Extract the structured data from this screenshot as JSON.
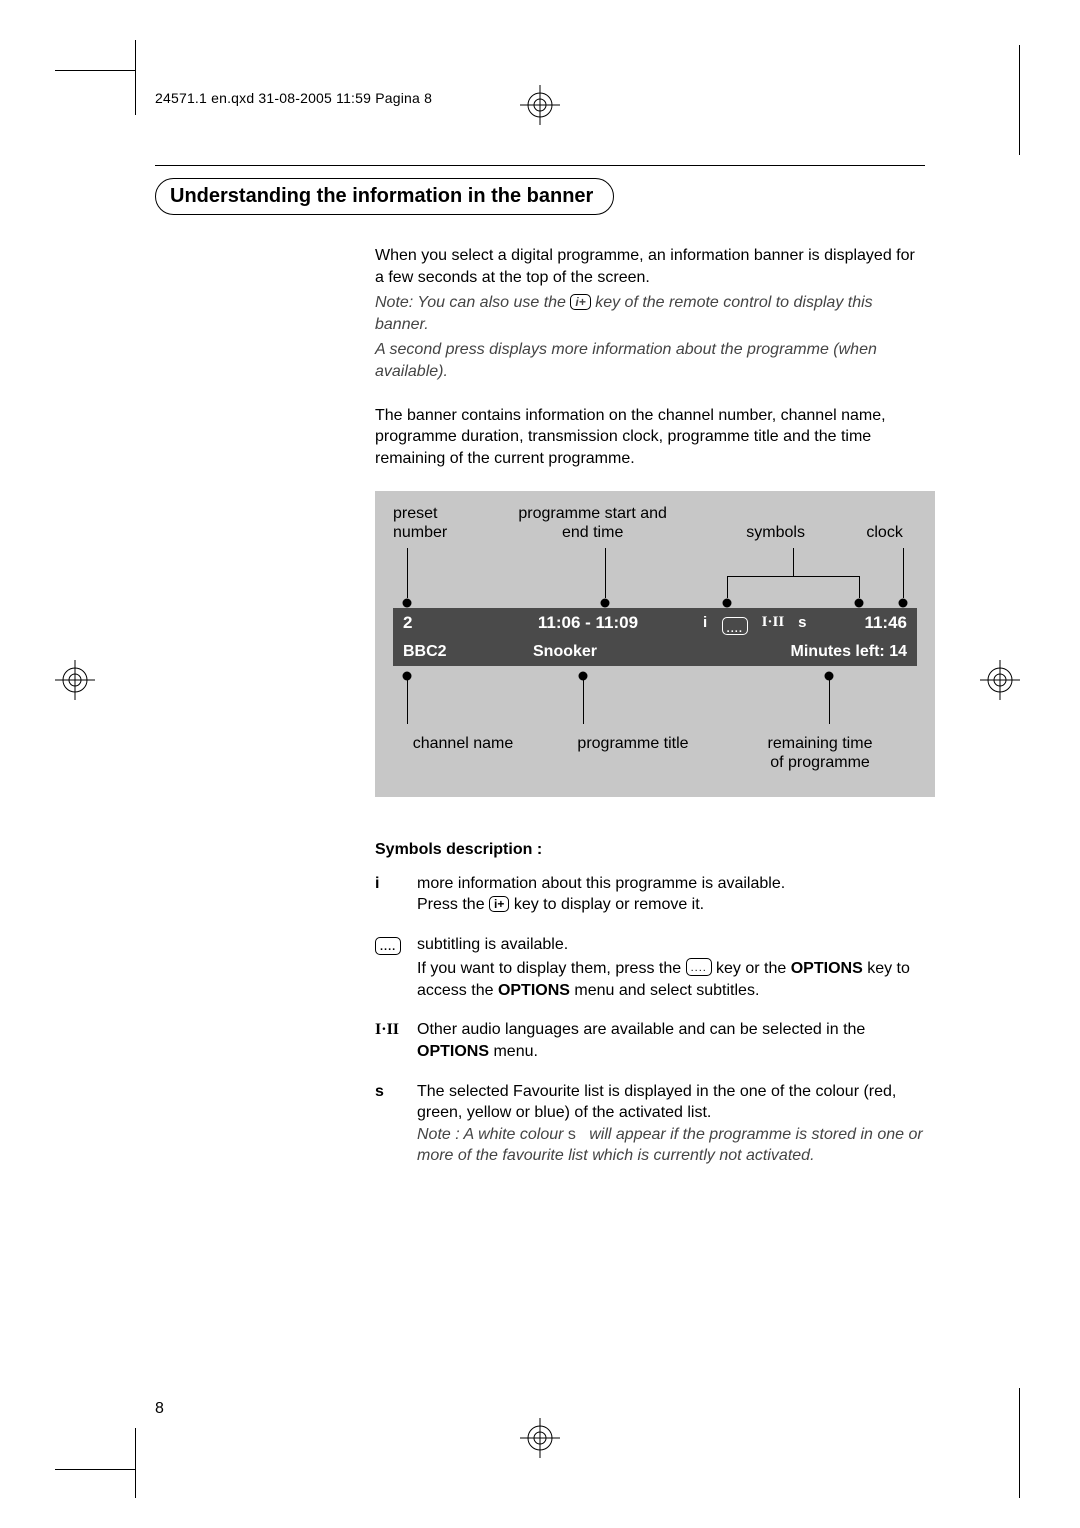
{
  "header_line": "24571.1 en.qxd  31-08-2005  11:59  Pagina 8",
  "title": "Understanding the information in the banner",
  "intro_line1": "When you select a digital programme, an information banner is displayed for a few seconds at the top of the screen.",
  "intro_note_prefix": "Note: You can also use the ",
  "intro_note_suffix": " key of the remote control to display this banner.",
  "intro_note2": "A second press displays more information about the programme (when available).",
  "para2": "The banner contains information on the channel number, channel name, programme duration, transmission clock, programme title and the time remaining of the current programme.",
  "labels_top": {
    "preset": "preset number",
    "time": "programme start and end time",
    "symbols": "symbols",
    "clock": "clock"
  },
  "banner": {
    "preset": "2",
    "time": "11:06 - 11:09",
    "sym_i": "i",
    "sym_iii": "I·II",
    "sym_s": "s",
    "clock": "11:46",
    "channel": "BBC2",
    "title": "Snooker",
    "remaining": "Minutes left: 14"
  },
  "labels_bot": {
    "channel": "channel name",
    "title": "programme title",
    "remaining1": "remaining time",
    "remaining2": "of programme"
  },
  "symdesc_heading": "Symbols description :",
  "sym_i_label": "i",
  "sym_i_text1": "more information about this programme is available.",
  "sym_i_text2a": "Press the ",
  "sym_i_text2b": " key to display or remove it.",
  "sym_sub_text1": "subtitling is available.",
  "sym_sub_text2a": "If you want to display them, press the ",
  "sym_sub_text2b": " key or the ",
  "sym_sub_text3a": "OPTIONS",
  "sym_sub_text3b": " key to access the ",
  "sym_sub_text3c": "OPTIONS",
  "sym_sub_text3d": " menu and select subtitles.",
  "sym_iii_label": "I·II",
  "sym_iii_text1": "Other audio languages are available and can be selected in the ",
  "sym_iii_text2": "OPTIONS",
  "sym_iii_text3": " menu.",
  "sym_s_label": "s",
  "sym_s_text1": "The selected Favourite list is displayed in the one of the colour (red, green, yellow or blue) of the activated list.",
  "sym_s_note_a": "Note : A white colour ",
  "sym_s_note_glyph": "s",
  "sym_s_note_b": " will appear if the programme is stored in one or more of the favourite list which is currently not activated.",
  "pagenum": "8"
}
